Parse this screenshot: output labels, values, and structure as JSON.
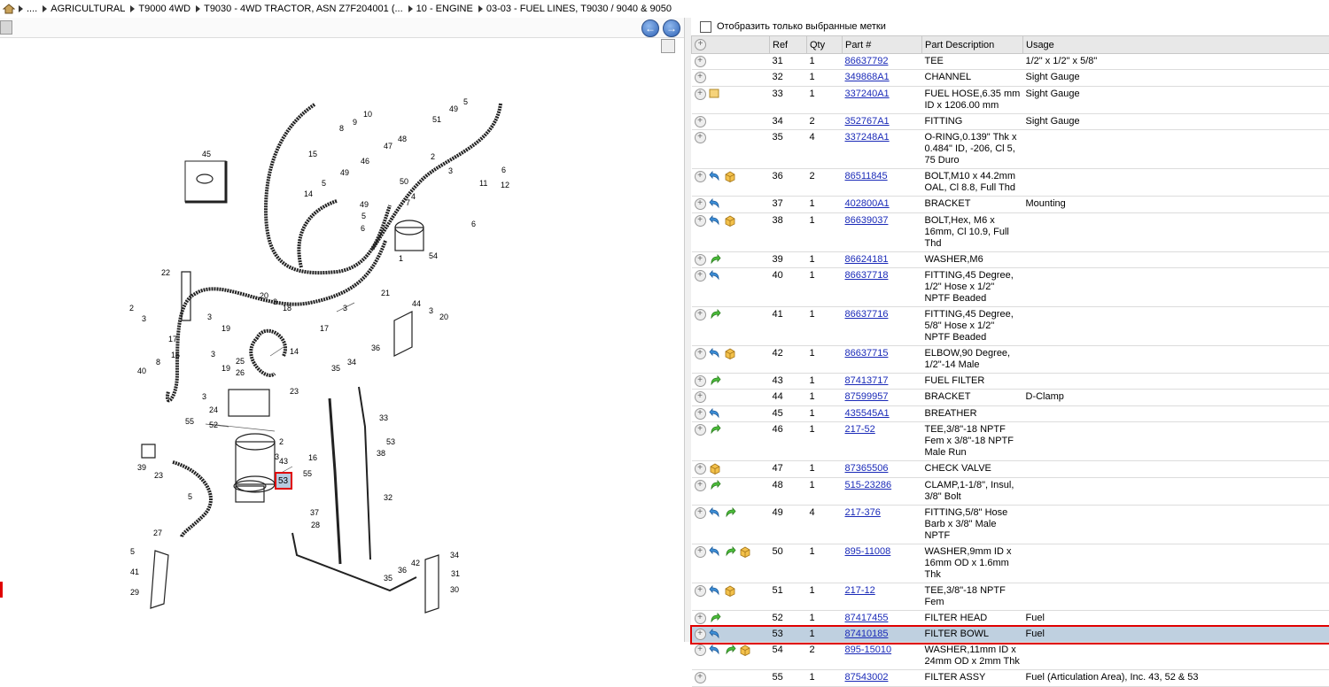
{
  "breadcrumb": {
    "items": [
      "....",
      "AGRICULTURAL",
      "T9000 4WD",
      "T9030 - 4WD TRACTOR, ASN Z7F204001 (...",
      "10 - ENGINE",
      "03-03 - FUEL LINES, T9030 / 9040 & 9050"
    ]
  },
  "filter": {
    "label": "Отобразить только выбранные метки"
  },
  "table": {
    "headers": {
      "ref": "Ref",
      "qty": "Qty",
      "part": "Part #",
      "desc": "Part Description",
      "usage": "Usage"
    },
    "rows": [
      {
        "ref": "31",
        "qty": "1",
        "part": "86637792",
        "desc": "TEE",
        "usage": "1/2\" x 1/2\" x 5/8\"",
        "icons": []
      },
      {
        "ref": "32",
        "qty": "1",
        "part": "349868A1",
        "desc": "CHANNEL",
        "usage": "Sight Gauge",
        "icons": []
      },
      {
        "ref": "33",
        "qty": "1",
        "part": "337240A1",
        "desc": "FUEL HOSE,6.35 mm ID x 1206.00 mm",
        "usage": "Sight Gauge",
        "icons": [
          "note"
        ]
      },
      {
        "ref": "34",
        "qty": "2",
        "part": "352767A1",
        "desc": "FITTING",
        "usage": "Sight Gauge",
        "icons": []
      },
      {
        "ref": "35",
        "qty": "4",
        "part": "337248A1",
        "desc": "O-RING,0.139\" Thk x 0.484\" ID, -206, Cl 5, 75 Duro",
        "usage": "",
        "icons": []
      },
      {
        "ref": "36",
        "qty": "2",
        "part": "86511845",
        "desc": "BOLT,M10 x 44.2mm OAL, Cl 8.8, Full Thd",
        "usage": "",
        "icons": [
          "back",
          "box"
        ]
      },
      {
        "ref": "37",
        "qty": "1",
        "part": "402800A1",
        "desc": "BRACKET",
        "usage": "Mounting",
        "icons": [
          "back"
        ]
      },
      {
        "ref": "38",
        "qty": "1",
        "part": "86639037",
        "desc": "BOLT,Hex, M6 x 16mm, Cl 10.9, Full Thd",
        "usage": "",
        "icons": [
          "back",
          "box"
        ]
      },
      {
        "ref": "39",
        "qty": "1",
        "part": "86624181",
        "desc": "WASHER,M6",
        "usage": "",
        "icons": [
          "fwd"
        ]
      },
      {
        "ref": "40",
        "qty": "1",
        "part": "86637718",
        "desc": "FITTING,45 Degree, 1/2\" Hose x 1/2\" NPTF Beaded",
        "usage": "",
        "icons": [
          "back"
        ]
      },
      {
        "ref": "41",
        "qty": "1",
        "part": "86637716",
        "desc": "FITTING,45 Degree, 5/8\" Hose x 1/2\" NPTF Beaded",
        "usage": "",
        "icons": [
          "fwd"
        ]
      },
      {
        "ref": "42",
        "qty": "1",
        "part": "86637715",
        "desc": "ELBOW,90 Degree, 1/2\"-14 Male",
        "usage": "",
        "icons": [
          "back",
          "box"
        ]
      },
      {
        "ref": "43",
        "qty": "1",
        "part": "87413717",
        "desc": "FUEL FILTER",
        "usage": "",
        "icons": [
          "fwd"
        ]
      },
      {
        "ref": "44",
        "qty": "1",
        "part": "87599957",
        "desc": "BRACKET",
        "usage": "D-Clamp",
        "icons": []
      },
      {
        "ref": "45",
        "qty": "1",
        "part": "435545A1",
        "desc": "BREATHER",
        "usage": "",
        "icons": [
          "back"
        ]
      },
      {
        "ref": "46",
        "qty": "1",
        "part": "217-52",
        "desc": "TEE,3/8\"-18 NPTF Fem x 3/8\"-18 NPTF Male Run",
        "usage": "",
        "icons": [
          "fwd"
        ]
      },
      {
        "ref": "47",
        "qty": "1",
        "part": "87365506",
        "desc": "CHECK VALVE",
        "usage": "",
        "icons": [
          "box"
        ]
      },
      {
        "ref": "48",
        "qty": "1",
        "part": "515-23286",
        "desc": "CLAMP,1-1/8\", Insul, 3/8\" Bolt",
        "usage": "",
        "icons": [
          "fwd"
        ]
      },
      {
        "ref": "49",
        "qty": "4",
        "part": "217-376",
        "desc": "FITTING,5/8\" Hose Barb x 3/8\" Male NPTF",
        "usage": "",
        "icons": [
          "back",
          "fwd"
        ]
      },
      {
        "ref": "50",
        "qty": "1",
        "part": "895-11008",
        "desc": "WASHER,9mm ID x 16mm OD x 1.6mm Thk",
        "usage": "",
        "icons": [
          "back",
          "fwd",
          "box"
        ]
      },
      {
        "ref": "51",
        "qty": "1",
        "part": "217-12",
        "desc": "TEE,3/8\"-18 NPTF Fem",
        "usage": "",
        "icons": [
          "back",
          "box"
        ]
      },
      {
        "ref": "52",
        "qty": "1",
        "part": "87417455",
        "desc": "FILTER HEAD",
        "usage": "Fuel",
        "icons": [
          "fwd"
        ]
      },
      {
        "ref": "53",
        "qty": "1",
        "part": "87410185",
        "desc": "FILTER BOWL",
        "usage": "Fuel",
        "icons": [
          "back"
        ],
        "selected": true
      },
      {
        "ref": "54",
        "qty": "2",
        "part": "895-15010",
        "desc": "WASHER,11mm ID x 24mm OD x 2mm Thk",
        "usage": "",
        "icons": [
          "back",
          "fwd",
          "box"
        ]
      },
      {
        "ref": "55",
        "qty": "1",
        "part": "87543002",
        "desc": "FILTER ASSY",
        "usage": "Fuel (Articulation Area), Inc. 43, 52 & 53",
        "icons": []
      }
    ]
  },
  "diagram": {
    "labels": [
      "45",
      "10",
      "9",
      "8",
      "15",
      "49",
      "5",
      "51",
      "2",
      "3",
      "11",
      "6",
      "12",
      "46",
      "47",
      "48",
      "50",
      "4",
      "7",
      "49",
      "14",
      "5",
      "49",
      "5",
      "6",
      "1",
      "54",
      "6",
      "22",
      "2",
      "3",
      "20",
      "3",
      "18",
      "21",
      "17",
      "3",
      "19",
      "3",
      "44",
      "3",
      "20",
      "17",
      "3",
      "14",
      "15",
      "8",
      "40",
      "25",
      "26",
      "19",
      "3",
      "34",
      "36",
      "35",
      "23",
      "24",
      "52",
      "55",
      "2",
      "3",
      "43",
      "33",
      "55",
      "53",
      "38",
      "39",
      "23",
      "5",
      "16",
      "32",
      "37",
      "28",
      "27",
      "5",
      "41",
      "29",
      "42",
      "36",
      "35",
      "34",
      "31",
      "30",
      "29"
    ],
    "selected_label": "53"
  }
}
